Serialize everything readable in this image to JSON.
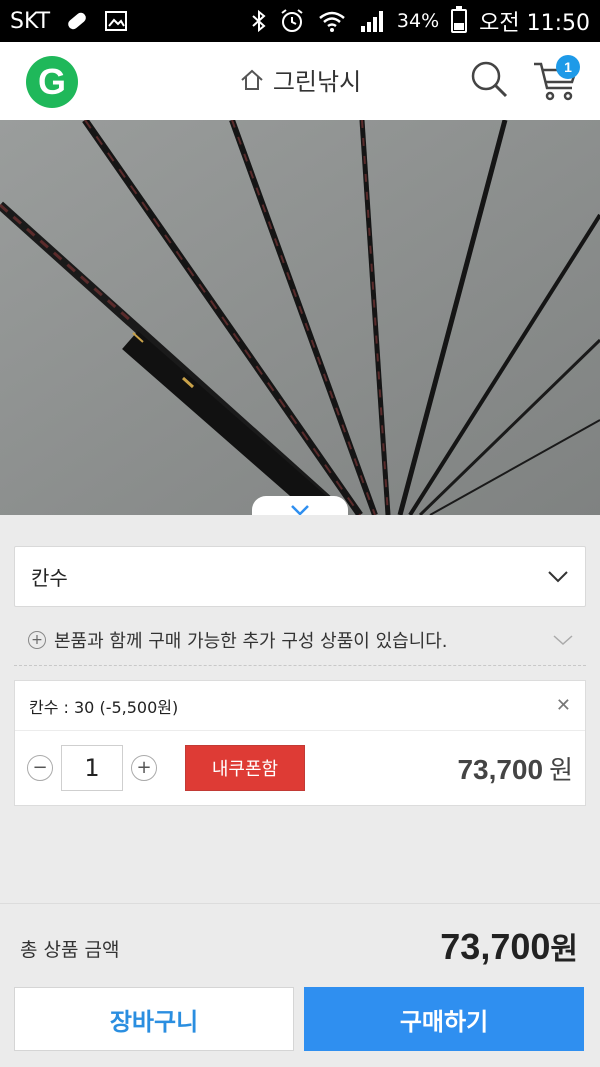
{
  "status_bar": {
    "carrier": "SKT",
    "battery": "34%",
    "time": "오전 11:50"
  },
  "header": {
    "title": "그린낚시",
    "cart_count": "1",
    "logo_letter": "G",
    "logo_color": "#1fb85a"
  },
  "options": {
    "select_label": "칸수",
    "addon_text": "본품과 함께 구매 가능한 추가 구성 상품이 있습니다.",
    "selected_option": {
      "label": "칸수 : 30 (-5,500원)",
      "quantity": "1",
      "coupon_label": "내쿠폰함",
      "price": "73,700",
      "currency": "원"
    }
  },
  "summary": {
    "total_label": "총 상품 금액",
    "total_value": "73,700",
    "currency": "원"
  },
  "actions": {
    "cart_button": "장바구니",
    "buy_button": "구매하기"
  },
  "colors": {
    "accent_blue": "#2f8ff0",
    "coupon_red": "#de3b35",
    "badge_blue": "#1e9ae8"
  }
}
